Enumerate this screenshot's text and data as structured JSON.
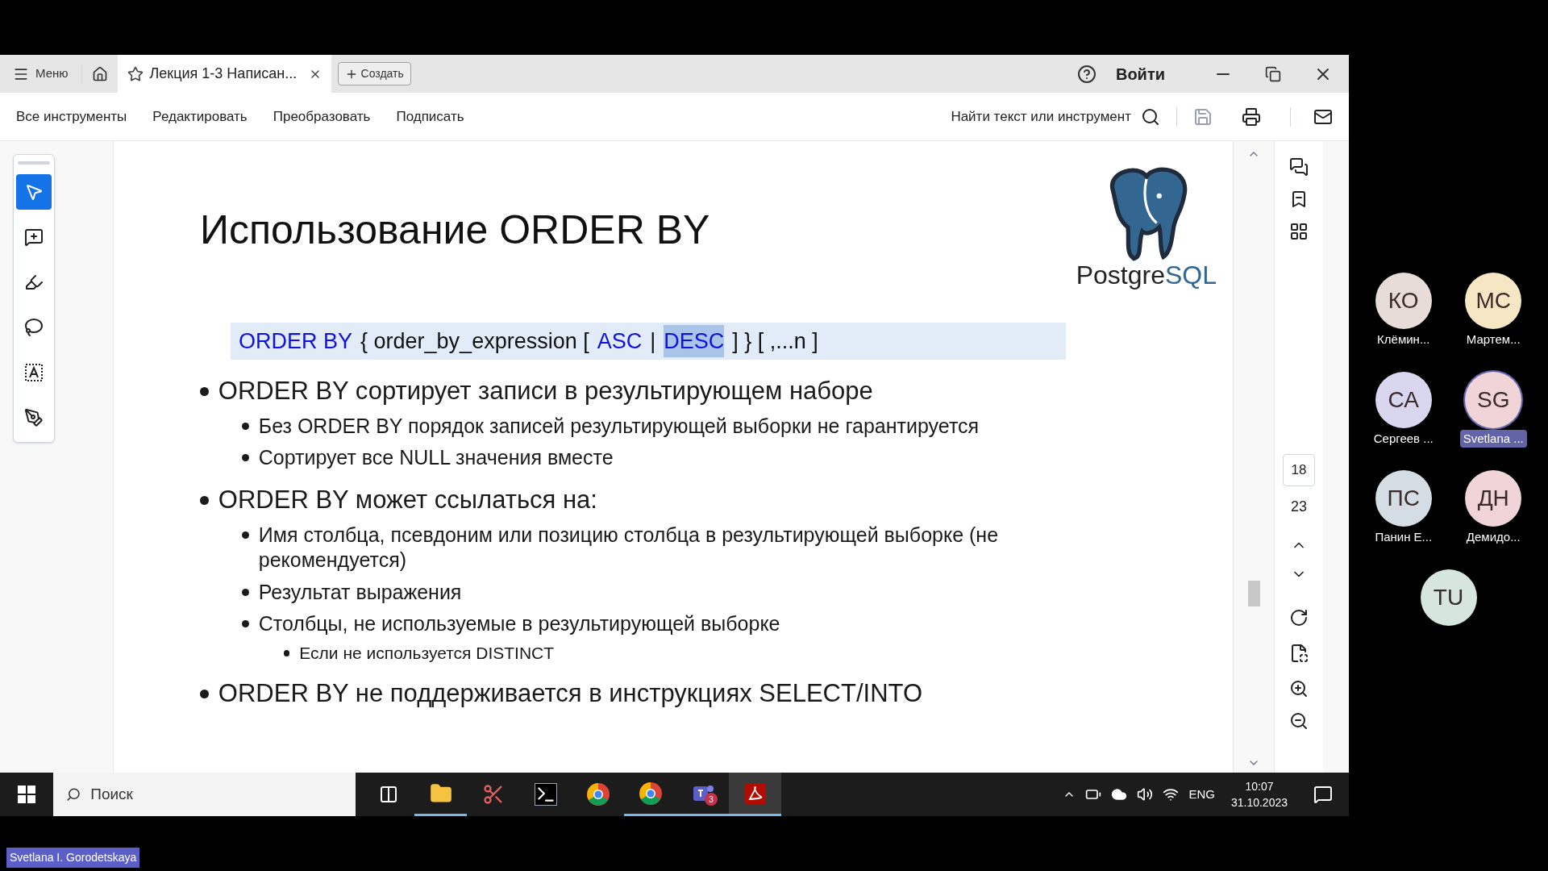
{
  "tabbar": {
    "menu": "Меню",
    "tab_title": "Лекция 1-3 Написан...",
    "create": "Создать",
    "signin": "Войти"
  },
  "toolbar": {
    "items": [
      "Все инструменты",
      "Редактировать",
      "Преобразовать",
      "Подписать"
    ],
    "search": "Найти текст или инструмент"
  },
  "tools": [
    {
      "kind": "select",
      "selected": true
    },
    {
      "kind": "comment",
      "selected": false
    },
    {
      "kind": "highlight",
      "selected": false
    },
    {
      "kind": "draw",
      "selected": false
    },
    {
      "kind": "textbox",
      "selected": false
    },
    {
      "kind": "sign",
      "selected": false
    }
  ],
  "slide": {
    "title": "Использование ORDER BY",
    "logo_text": "Postgre",
    "logo_text_accent": "SQL",
    "syntax": [
      {
        "text": "ORDER BY",
        "kind": "keyword"
      },
      {
        "text": "{ order_by_expression [",
        "kind": "plain"
      },
      {
        "text": "ASC",
        "kind": "keyword"
      },
      {
        "text": "|",
        "kind": "plain"
      },
      {
        "text": "DESC",
        "kind": "selected"
      },
      {
        "text": "] } [ ,...n ]",
        "kind": "plain"
      }
    ],
    "bullets": [
      {
        "text": "ORDER BY сортирует записи в результирующем наборе",
        "children": [
          {
            "text": "Без ORDER BY порядок записей результирующей выборки не гарантируется"
          },
          {
            "text": "Сортирует все NULL значения вместе"
          }
        ]
      },
      {
        "text": "ORDER BY может ссылаться на:",
        "children": [
          {
            "text": "Имя столбца, псевдоним или позицию столбца в результирующей выборке (не рекомендуется)"
          },
          {
            "text": "Результат выражения"
          },
          {
            "text": "Столбцы, не используемые в результирующей выборке",
            "children": [
              {
                "text": "Если не используется DISTINCT"
              }
            ]
          }
        ]
      },
      {
        "text": "ORDER BY не поддерживается в инструкциях SELECT/INTO"
      }
    ]
  },
  "page": {
    "current": "18",
    "total": "23"
  },
  "participants": [
    {
      "initials": "КО",
      "name": "Клёмин...",
      "color": "#e8dcd8",
      "highlighted": false
    },
    {
      "initials": "МС",
      "name": "Мартем...",
      "color": "#f5e6c4",
      "highlighted": false
    },
    {
      "initials": "СА",
      "name": "Сергеев ...",
      "color": "#d9d6f0",
      "highlighted": false
    },
    {
      "initials": "SG",
      "name": "Svetlana ...",
      "color": "#f0d4d8",
      "highlighted": true
    },
    {
      "initials": "ПС",
      "name": "Панин Е...",
      "color": "#d4dde3",
      "highlighted": false
    },
    {
      "initials": "ДН",
      "name": "Демидо...",
      "color": "#f0d4d8",
      "highlighted": false
    },
    {
      "initials": "TU",
      "color": "#d6e6de"
    }
  ],
  "taskbar": {
    "search_placeholder": "Поиск",
    "apps": [
      {
        "kind": "taskview",
        "active": false
      },
      {
        "kind": "explorer",
        "active": true
      },
      {
        "kind": "snip",
        "active": false
      },
      {
        "kind": "terminal",
        "active": false
      },
      {
        "kind": "chrome",
        "active": false
      },
      {
        "kind": "chrome",
        "active": true
      },
      {
        "kind": "teams",
        "active": true,
        "badge": "3"
      },
      {
        "kind": "acrobat",
        "active": true
      }
    ],
    "lang": "ENG",
    "time": "10:07",
    "date": "31.10.2023"
  },
  "presenter": "Svetlana I. Gorodetskaya"
}
